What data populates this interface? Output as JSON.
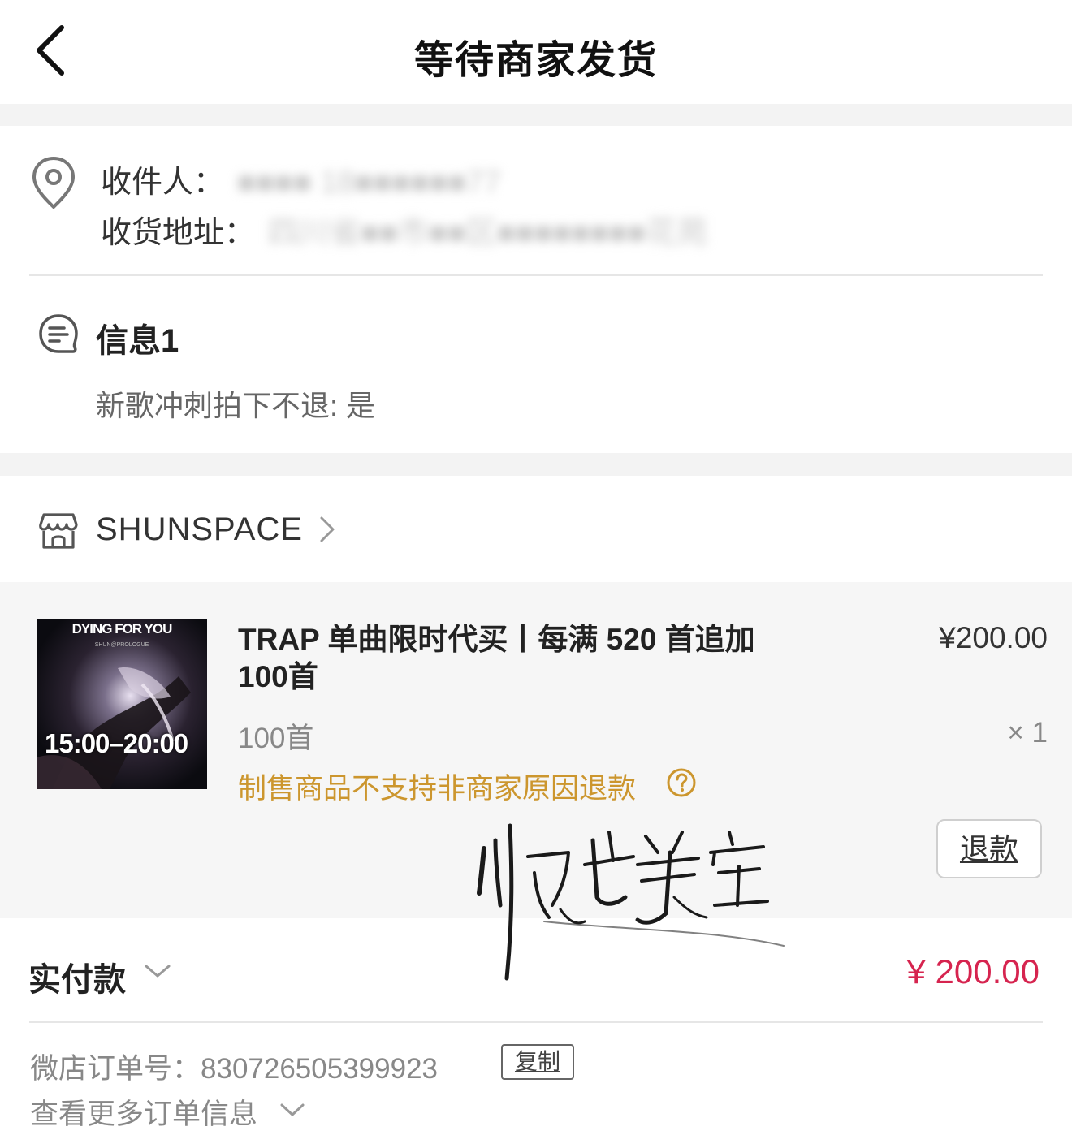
{
  "header": {
    "title": "等待商家发货",
    "back_icon": "chevron-left-icon"
  },
  "address": {
    "recipient_label": "收件人：",
    "recipient_value": "■■■■ 18■■■■■■77",
    "address_label": "收货地址：",
    "address_value": "四川省■■市■■区■■■■■■■■花苑",
    "pin_icon": "location-pin-icon"
  },
  "info": {
    "title": "信息1",
    "content": "新歌冲刺拍下不退: 是",
    "icon": "message-icon"
  },
  "store": {
    "name": "SHUNSPACE",
    "icon": "store-icon"
  },
  "product": {
    "thumb_title": "DYING FOR YOU",
    "thumb_subtitle": "SHUN@PROLOGUE",
    "thumb_time": "15:00–20:00",
    "name": "TRAP 单曲限时代买丨每满 520 首追加 100首",
    "price": "¥200.00",
    "sku": "100首",
    "qty": "× 1",
    "refund_note": "制售商品不支持非商家原因退款",
    "refund_button": "退款"
  },
  "payment": {
    "label": "实付款",
    "amount": "¥ 200.00",
    "accent_color": "#d6244f"
  },
  "order": {
    "number_label": "微店订单号：",
    "number": "830726505399923",
    "copy_button": "复制",
    "more_info": "查看更多订单信息"
  },
  "watermark": {
    "text": "顺志美宝"
  }
}
